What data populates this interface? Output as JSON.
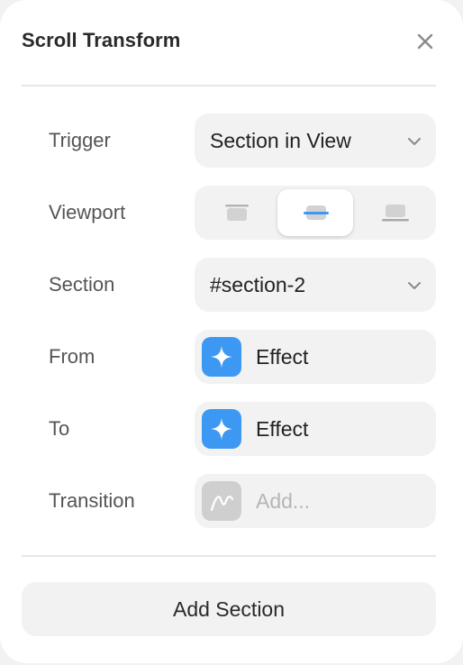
{
  "panel": {
    "title": "Scroll Transform",
    "close_icon": "close-icon"
  },
  "fields": {
    "trigger": {
      "label": "Trigger",
      "value": "Section in View",
      "icon": "chevron-down-icon"
    },
    "viewport": {
      "label": "Viewport",
      "options": [
        {
          "name": "align-top-icon",
          "selected": false
        },
        {
          "name": "align-center-icon",
          "selected": true
        },
        {
          "name": "align-bottom-icon",
          "selected": false
        }
      ]
    },
    "section": {
      "label": "Section",
      "value": "#section-2",
      "icon": "chevron-down-icon"
    },
    "from": {
      "label": "From",
      "value": "Effect",
      "icon": "sparkle-icon"
    },
    "to": {
      "label": "To",
      "value": "Effect",
      "icon": "sparkle-icon"
    },
    "transition": {
      "label": "Transition",
      "placeholder": "Add...",
      "icon": "curve-icon"
    }
  },
  "footer": {
    "add_section_label": "Add Section"
  },
  "colors": {
    "accent": "#3d98f4",
    "control_bg": "#f2f2f2",
    "muted_tile": "#cfcfcf"
  }
}
